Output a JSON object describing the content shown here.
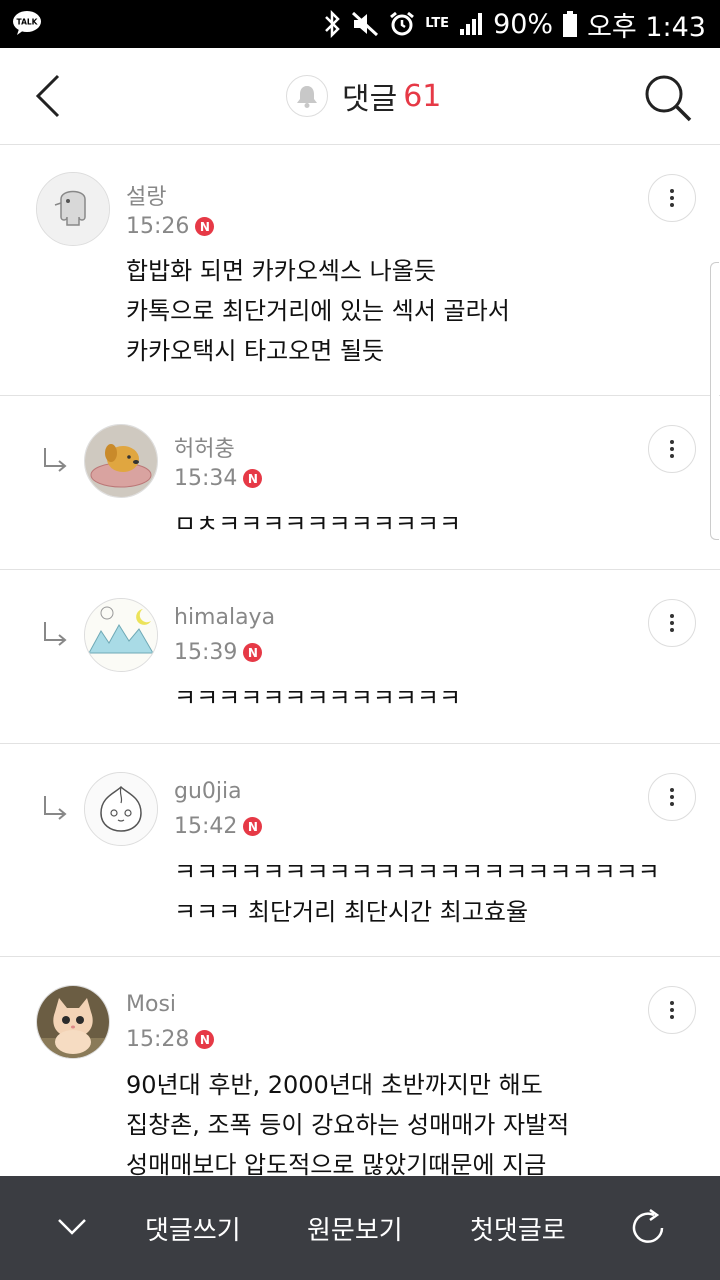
{
  "status_bar": {
    "app_icon": "kakaotalk-icon",
    "app_icon_text": "TALK",
    "network": "LTE",
    "battery": "90%",
    "time": "오후 1:43"
  },
  "header": {
    "title": "댓글",
    "count": "61"
  },
  "comments": [
    {
      "author": "설랑",
      "time": "15:26",
      "badge": "N",
      "lines": [
        "합밥화 되면 카카오섹스 나올듯",
        "카톡으로 최단거리에 있는 섹서 골라서",
        "카카오택시 타고오면 될듯"
      ]
    },
    {
      "author": "허허충",
      "time": "15:34",
      "badge": "N",
      "lines": [
        "ㅁㅊㅋㅋㅋㅋㅋㅋㅋㅋㅋㅋㅋ"
      ]
    },
    {
      "author": "himalaya",
      "time": "15:39",
      "badge": "N",
      "lines": [
        "ㅋㅋㅋㅋㅋㅋㅋㅋㅋㅋㅋㅋㅋ"
      ]
    },
    {
      "author": "gu0jia",
      "time": "15:42",
      "badge": "N",
      "lines": [
        "ㅋㅋㅋㅋㅋㅋㅋㅋㅋㅋㅋㅋㅋㅋㅋㅋㅋㅋㅋㅋㅋㅋ",
        "ㅋㅋㅋ 최단거리 최단시간 최고효율"
      ]
    },
    {
      "author": "Mosi",
      "time": "15:28",
      "badge": "N",
      "lines": [
        "90년대 후반, 2000년대 초반까지만 해도",
        "집창촌, 조폭 등이 강요하는 성매매가 자발적",
        "성매매보다 압도적으로 많았기때문에 지금"
      ]
    }
  ],
  "bottom_bar": {
    "write_label": "댓글쓰기",
    "original_label": "원문보기",
    "first_label": "첫댓글로"
  }
}
